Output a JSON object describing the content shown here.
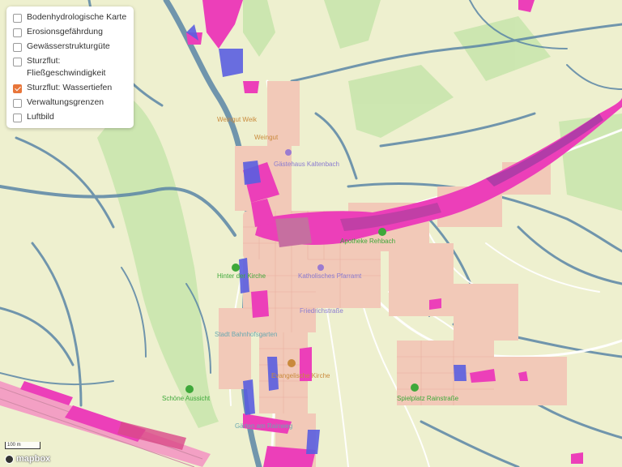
{
  "layer_panel": {
    "items": [
      {
        "label": "Bodenhydrologische Karte",
        "checked": false
      },
      {
        "label": "Erosionsgefährdung",
        "checked": false
      },
      {
        "label": "Gewässerstrukturgüte",
        "checked": false
      },
      {
        "label": "Sturzflut: Fließgeschwindigkeit",
        "checked": false
      },
      {
        "label": "Sturzflut: Wassertiefen",
        "checked": true
      },
      {
        "label": "Verwaltungsgrenzen",
        "checked": false
      },
      {
        "label": "Luftbild",
        "checked": false
      }
    ]
  },
  "scale": {
    "label": "100 m"
  },
  "attribution": {
    "logo_text": "mapbox"
  },
  "map_labels": {
    "weingut": "Weingut Weik",
    "weingut2": "Weingut",
    "gaestehaus": "Gästehaus Kaltenbach",
    "apotheke": "Apotheke Rehbach",
    "hinter": "Hinter der Kirche",
    "pfarrhaus": "Katholisches Pfarramt",
    "friedrich": "Friedrichstraße",
    "aussicht": "Schöne Aussicht",
    "kirche": "Evangelische Kirche",
    "spielplatz": "Spielplatz Rainstraße",
    "garten": "Gärten am Rainweg",
    "stadt": "Stadt Bahnhofsgarten"
  },
  "colors": {
    "base": "#eef0cf",
    "meadow": "#c7e6ad",
    "water_shallow": "#5b86a6",
    "water_mid": "#5a5ee0",
    "water_deep": "#ec3fb9",
    "buildings": "#f2c9b8",
    "roads": "#ffffff",
    "checkbox_checked": "#e8763a",
    "poi_green": "#3ea83a",
    "poi_orange": "#c98a3c"
  }
}
